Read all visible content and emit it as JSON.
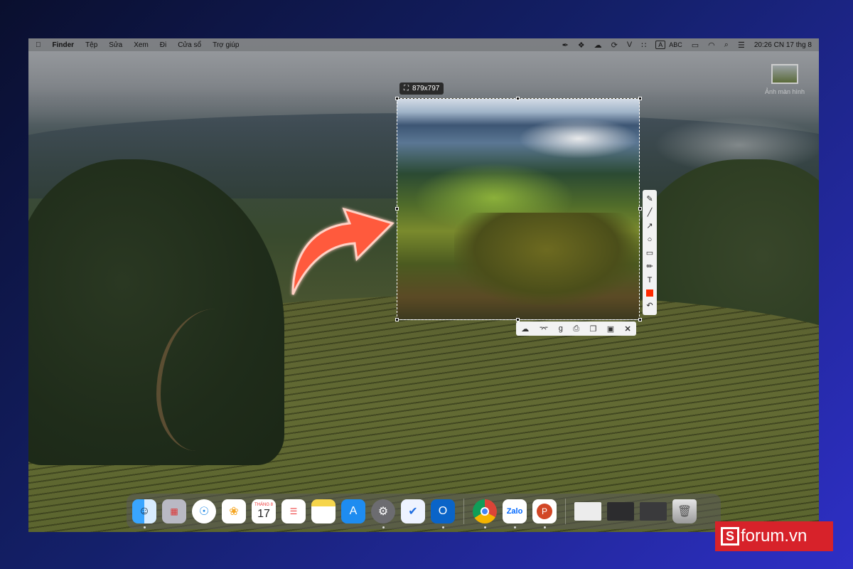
{
  "menubar": {
    "apple_icon": "apple-icon",
    "items": [
      "Finder",
      "Tệp",
      "Sửa",
      "Xem",
      "Đi",
      "Cửa sổ",
      "Trợ giúp"
    ],
    "tray": {
      "input_label_a": "A",
      "input_label_abc": "ABC",
      "clock": "20:26 CN 17 thg 8"
    }
  },
  "desktop": {
    "file_name": "Ảnh màn hình"
  },
  "capture": {
    "size_label": "879x797",
    "annotation_color": "#ff2a00",
    "side_tools": [
      "pencil-icon",
      "line-icon",
      "arrow-icon",
      "ellipse-icon",
      "rectangle-icon",
      "marker-icon",
      "text-icon",
      "color-icon",
      "undo-icon"
    ],
    "bottom_tools": [
      "cloud-upload-icon",
      "share-icon",
      "google-search-icon",
      "print-icon",
      "copy-icon",
      "save-icon",
      "close-icon"
    ],
    "text_tool_glyph": "T"
  },
  "dock": {
    "calendar_month": "THÁNG 8",
    "calendar_day": "17",
    "zalo_label": "Zalo",
    "apps": [
      "Finder",
      "Launchpad",
      "Safari",
      "Photos",
      "Calendar",
      "Reminders",
      "Notes",
      "App Store",
      "System Settings",
      "Lark",
      "Outlook",
      "Chrome",
      "Zalo",
      "PowerPoint"
    ]
  },
  "watermark": {
    "logo_letter": "S",
    "text": "forum.vn"
  }
}
